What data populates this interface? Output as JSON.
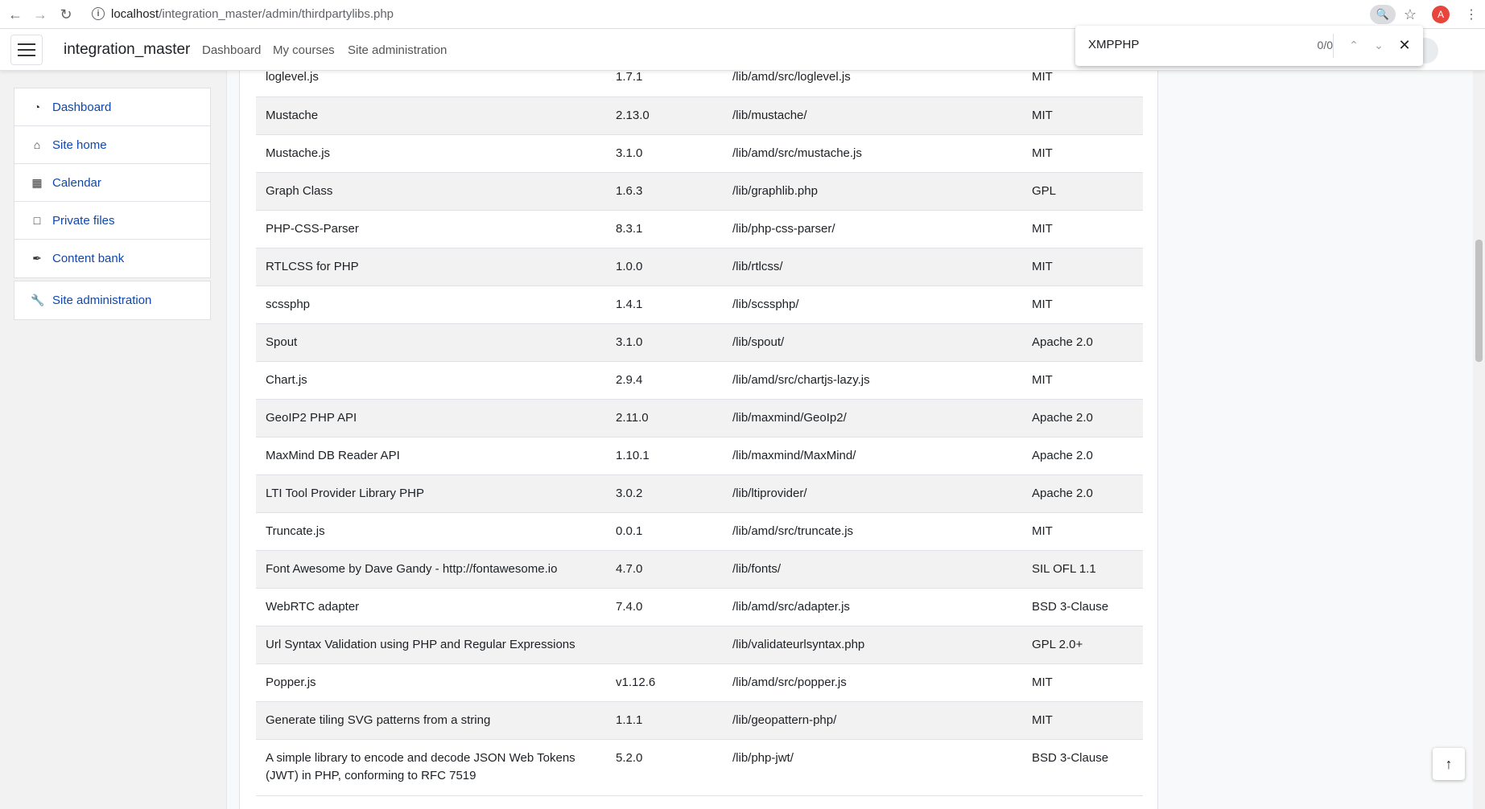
{
  "browser": {
    "url_host": "localhost",
    "url_path": "/integration_master/admin/thirdpartylibs.php",
    "profile_initial": "A"
  },
  "findbar": {
    "query": "XMPPHP",
    "count": "0/0"
  },
  "navbar": {
    "brand": "integration_master",
    "links": [
      "Dashboard",
      "My courses",
      "Site administration"
    ]
  },
  "drawer": {
    "items": [
      {
        "label": "Dashboard",
        "icon": "dashboard-icon"
      },
      {
        "label": "Site home",
        "icon": "home-icon"
      },
      {
        "label": "Calendar",
        "icon": "calendar-icon"
      },
      {
        "label": "Private files",
        "icon": "file-icon"
      },
      {
        "label": "Content bank",
        "icon": "paintbrush-icon"
      }
    ],
    "admin": {
      "label": "Site administration",
      "icon": "wrench-icon"
    }
  },
  "table": {
    "rows": [
      [
        "loglevel.js",
        "1.7.1",
        "/lib/amd/src/loglevel.js",
        "MIT"
      ],
      [
        "Mustache",
        "2.13.0",
        "/lib/mustache/",
        "MIT"
      ],
      [
        "Mustache.js",
        "3.1.0",
        "/lib/amd/src/mustache.js",
        "MIT"
      ],
      [
        "Graph Class",
        "1.6.3",
        "/lib/graphlib.php",
        "GPL"
      ],
      [
        "PHP-CSS-Parser",
        "8.3.1",
        "/lib/php-css-parser/",
        "MIT"
      ],
      [
        "RTLCSS for PHP",
        "1.0.0",
        "/lib/rtlcss/",
        "MIT"
      ],
      [
        "scssphp",
        "1.4.1",
        "/lib/scssphp/",
        "MIT"
      ],
      [
        "Spout",
        "3.1.0",
        "/lib/spout/",
        "Apache 2.0"
      ],
      [
        "Chart.js",
        "2.9.4",
        "/lib/amd/src/chartjs-lazy.js",
        "MIT"
      ],
      [
        "GeoIP2 PHP API",
        "2.11.0",
        "/lib/maxmind/GeoIp2/",
        "Apache 2.0"
      ],
      [
        "MaxMind DB Reader API",
        "1.10.1",
        "/lib/maxmind/MaxMind/",
        "Apache 2.0"
      ],
      [
        "LTI Tool Provider Library PHP",
        "3.0.2",
        "/lib/ltiprovider/",
        "Apache 2.0"
      ],
      [
        "Truncate.js",
        "0.0.1",
        "/lib/amd/src/truncate.js",
        "MIT"
      ],
      [
        "Font Awesome by Dave Gandy - http://fontawesome.io",
        "4.7.0",
        "/lib/fonts/",
        "SIL OFL 1.1"
      ],
      [
        "WebRTC adapter",
        "7.4.0",
        "/lib/amd/src/adapter.js",
        "BSD 3-Clause"
      ],
      [
        "Url Syntax Validation using PHP and Regular Expressions",
        "",
        "/lib/validateurlsyntax.php",
        "GPL 2.0+"
      ],
      [
        "Popper.js",
        "v1.12.6",
        "/lib/amd/src/popper.js",
        "MIT"
      ],
      [
        "Generate tiling SVG patterns from a string",
        "1.1.1",
        "/lib/geopattern-php/",
        "MIT"
      ],
      [
        "A simple library to encode and decode JSON Web Tokens (JWT) in PHP, conforming to RFC 7519",
        "5.2.0",
        "/lib/php-jwt/",
        "BSD 3-Clause"
      ]
    ]
  }
}
